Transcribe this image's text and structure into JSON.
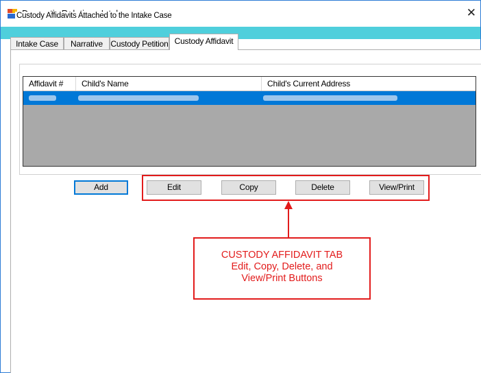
{
  "window": {
    "title": "Domestic Relations Intake",
    "close_glyph": "✕"
  },
  "tabs": [
    {
      "label": "Intake Case",
      "active": false
    },
    {
      "label": "Narrative",
      "active": false
    },
    {
      "label": "Custody Petition",
      "active": false
    },
    {
      "label": "Custody Affidavit",
      "active": true
    }
  ],
  "groupbox": {
    "legend": "Custody Affidavits Attached to the Intake Case"
  },
  "grid": {
    "columns": [
      "Affidavit #",
      "Child's Name",
      "Child's Current Address"
    ],
    "selected_row_note": "redacted"
  },
  "buttons": {
    "add": "Add",
    "edit": "Edit",
    "copy": "Copy",
    "delete": "Delete",
    "view_print": "View/Print"
  },
  "callout": {
    "lines": [
      "CUSTODY AFFIDAVIT TAB",
      "Edit, Copy, Delete, and",
      "View/Print Buttons"
    ]
  },
  "colors": {
    "accent_band": "#4fcfdc",
    "selection": "#0078d7",
    "annotation_red": "#e21b1b"
  },
  "icons": {
    "app": "app-window-icon",
    "close": "close-icon",
    "arrow": "up-arrow-icon"
  }
}
